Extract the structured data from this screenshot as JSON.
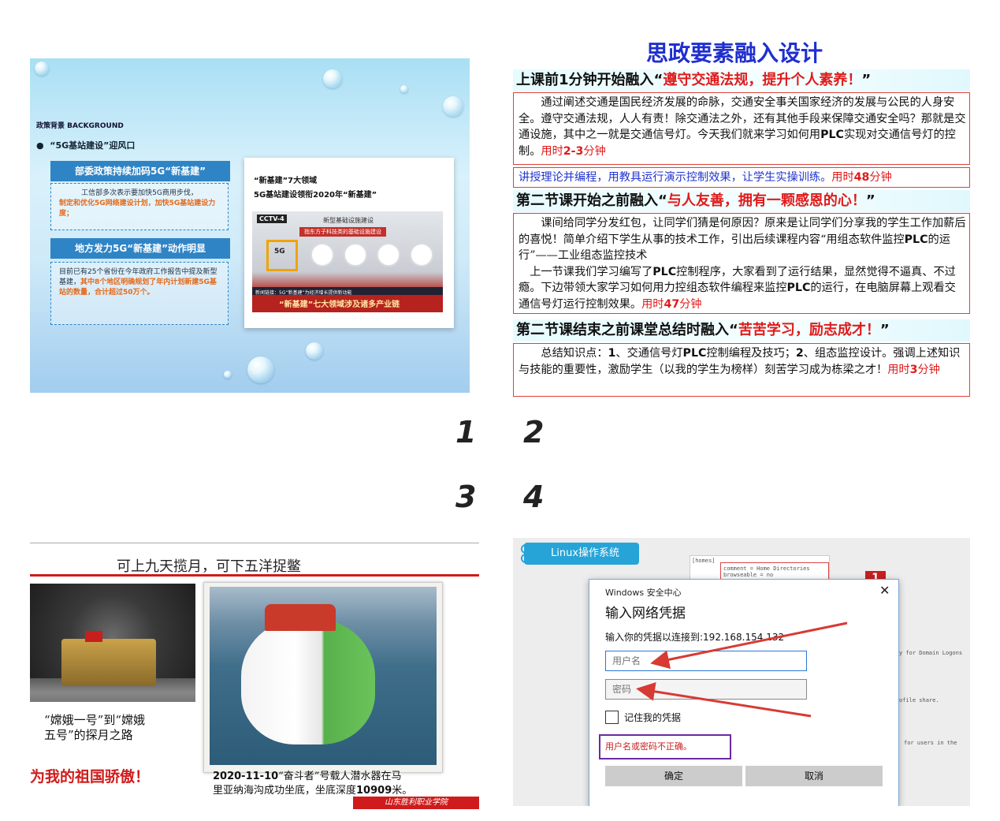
{
  "panel_labels": {
    "n1": "1",
    "n2": "2",
    "n3": "3",
    "n4": "4"
  },
  "slide1": {
    "section_label": "政策背景 BACKGROUND",
    "bullet": "“5G基站建设”迎风口",
    "box1": {
      "heading": "部委政策持续加码5G“新基建”",
      "text": "工信部多次表示要加快5G商用步伐，",
      "highlight": "制定和优化5G网络建设计划，加快5G基站建设力度；"
    },
    "box2": {
      "heading": "地方发力5G“新基建”动作明显",
      "text": "目前已有25个省份在今年政府工作报告中提及新型基建，",
      "highlight": "其中8个地区明确规划了年内计划新建5G基站的数量，合计超过50万个。"
    },
    "card": {
      "line1": "“新基建”7大领域",
      "line2": "5G基站建设领衔2020年“新基建”",
      "tv_logo": "CCTV-4",
      "tv_heading": "新型基础设施建设",
      "tv_subheading": "指东方子科技类的基础设施建设",
      "tv_icon_label": "5G",
      "tv_strip": "新闻链接：5G“新基建”为经济增长提供新动能",
      "tv_caption": "“新基建”七大领域涉及诸多产业链"
    }
  },
  "text2": {
    "title": "思政要素融入设计",
    "bar1": {
      "prefix": "上课前1分钟开始融入“",
      "red": "遵守交通法规，提升个人素养！",
      "suffix": "”"
    },
    "para1": {
      "text": "通过阐述交通是国民经济发展的命脉，交通安全事关国家经济的发展与公民的人身安全。遵守交通法规，人人有责！除交通法之外，还有其他手段来保障交通安全吗？那就是交通设施，其中之一就是交通信号灯。今天我们就来学习如何用",
      "bold": "PLC",
      "text2": "实现对交通信号灯的控制。",
      "red_prefix": "用时",
      "red_bold": "2-3",
      "red_suffix": "分钟"
    },
    "bar_b": {
      "text": "讲授理论并编程，用教具运行演示控制效果，让学生实操训练。",
      "red_prefix": "用时",
      "red_bold": "48",
      "red_suffix": "分钟"
    },
    "bar2": {
      "prefix": "第二节课开始之前融入“",
      "red": "与人友善，拥有一颗感恩的心！",
      "suffix": "”"
    },
    "para2": {
      "text": "课间给同学分发红包，让同学们猜是何原因？原来是让同学们分享我的学生工作加薪后的喜悦！简单介绍下学生从事的技术工作，引出后续课程内容“用组态软件监控",
      "bold": "PLC",
      "text2": "的运行”——工业组态监控技术",
      "line2": "上一节课我们学习编写了",
      "bold2": "PLC",
      "line2b": "控制程序，大家看到了运行结果，显然觉得不逼真、不过瘾。下边带领大家学习如何用力控组态软件编程来监控",
      "bold3": "PLC",
      "line2c": "的运行，在电脑屏幕上观看交通信号灯运行控制效果。",
      "red_prefix": "用时",
      "red_bold": "47",
      "red_suffix": "分钟"
    },
    "bar3": {
      "prefix": "第二节课结束之前课堂总结时融入“",
      "red": "苦苦学习，励志成才！",
      "suffix": "”"
    },
    "para3": {
      "t1": "总结知识点：",
      "b1": "1",
      "t2": "、交通信号灯",
      "b2": "PLC",
      "t3": "控制编程及技巧；",
      "b3": "2",
      "t4": "、组态监控设计。强调上述知识与技能的重要性，激励学生（以我的学生为榜样）刻苦学习成为栋梁之才！",
      "red_prefix": "用时",
      "red_bold": "3",
      "red_suffix": "分钟"
    }
  },
  "slide3": {
    "title": "可上九天揽月，可下五洋捉鳖",
    "caption1_a": "“嫦娥一号”到“嫦娥",
    "caption1_b": "五号”的探月之路",
    "slogan": "为我的祖国骄傲！",
    "caption2_a_bold": "2020-11-10",
    "caption2_a": "“奋斗者”号载人潜水器在马",
    "caption2_b": "里亚纳海沟成功坐底，坐底深度",
    "caption2_b_bold": "10909",
    "caption2_b_end": "米。",
    "school": "山东胜利职业学院"
  },
  "screen4": {
    "pill": "Linux操作系统",
    "code_l1": "[homes]",
    "code_l2": "comment = Home Directories",
    "code_l3": "browseable = no",
    "badge": "1",
    "side1": "y for Domain Logons",
    "side2": "ofile share.",
    "side3": "for users in the",
    "dialog": {
      "app": "Windows 安全中心",
      "close": "✕",
      "title": "输入网络凭据",
      "prompt": "输入你的凭据以连接到:192.168.154.132",
      "username_placeholder": "用户名",
      "password_placeholder": "密码",
      "remember": "记住我的凭据",
      "error": "用户名或密码不正确。",
      "ok": "确定",
      "cancel": "取消"
    }
  }
}
